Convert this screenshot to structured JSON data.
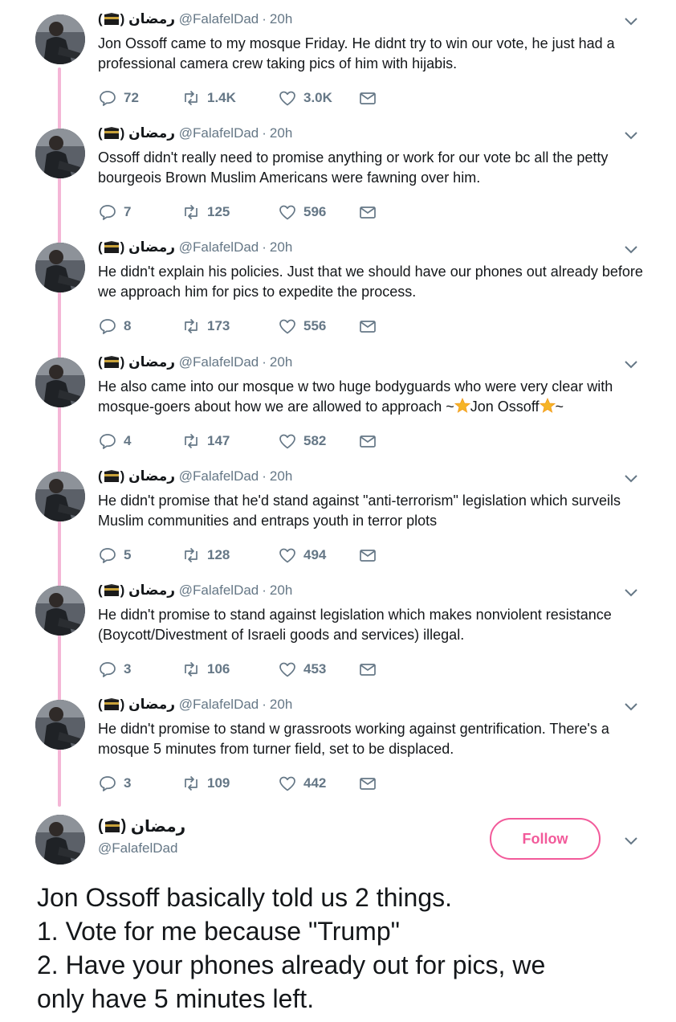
{
  "author": {
    "display_name": "رمضان",
    "handle": "@FalafelDad"
  },
  "separator": "·",
  "colors": {
    "accent": "#f25a9a",
    "thread_line": "#f4b6d6",
    "meta": "#657786"
  },
  "icons": [
    "avatar",
    "kaaba-emoji",
    "reply-icon",
    "retweet-icon",
    "like-icon",
    "message-icon",
    "chevron-down-icon",
    "star-emoji"
  ],
  "tweets": [
    {
      "time": "20h",
      "text": "Jon Ossoff came to my mosque Friday. He didnt try to win our vote, he just had a professional camera crew taking pics of him with hijabis.",
      "replies": "72",
      "retweets": "1.4K",
      "likes": "3.0K"
    },
    {
      "time": "20h",
      "text": "Ossoff didn't really need to promise anything or work for our vote bc all the petty bourgeois Brown Muslim Americans were fawning over him.",
      "replies": "7",
      "retweets": "125",
      "likes": "596"
    },
    {
      "time": "20h",
      "text": "He didn't explain his policies. Just that we should have our phones out already before we approach him for pics to expedite the process.",
      "replies": "8",
      "retweets": "173",
      "likes": "556"
    },
    {
      "time": "20h",
      "text_before": "He also came into our mosque w two huge bodyguards who were very clear with mosque-goers about how we are allowed to approach ~",
      "text_name": "Jon Ossoff",
      "text_after": "~",
      "replies": "4",
      "retweets": "147",
      "likes": "582"
    },
    {
      "time": "20h",
      "text": "He didn't promise that he'd stand against \"anti-terrorism\" legislation which surveils Muslim communities and entraps youth in terror plots",
      "replies": "5",
      "retweets": "128",
      "likes": "494"
    },
    {
      "time": "20h",
      "text": "He didn't promise to stand against legislation which makes nonviolent resistance (Boycott/Divestment of Israeli goods and services) illegal.",
      "replies": "3",
      "retweets": "106",
      "likes": "453"
    },
    {
      "time": "20h",
      "text": "He didn't promise to stand w grassroots working against gentrification. There's a mosque 5 minutes from turner field, set to be displaced.",
      "replies": "3",
      "retweets": "109",
      "likes": "442"
    }
  ],
  "main_tweet": {
    "follow_label": "Follow",
    "lines": [
      "Jon Ossoff basically told us 2 things.",
      "1. Vote for me because \"Trump\"",
      "2. Have your phones already out for pics, we",
      "only have 5 minutes left."
    ]
  }
}
